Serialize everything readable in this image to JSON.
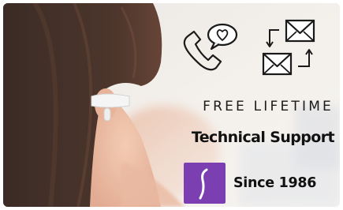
{
  "banner": {
    "headline": "FREE LIFETIME",
    "subhead": "Technical Support",
    "since": "Since 1986"
  },
  "icons": {
    "contact_phone": "phone-with-heart-bubble-icon",
    "contact_mail": "exchange-envelopes-icon",
    "brand": "brand-logo-icon"
  },
  "colors": {
    "brand_purple": "#7c3fb2",
    "text": "#111111"
  }
}
